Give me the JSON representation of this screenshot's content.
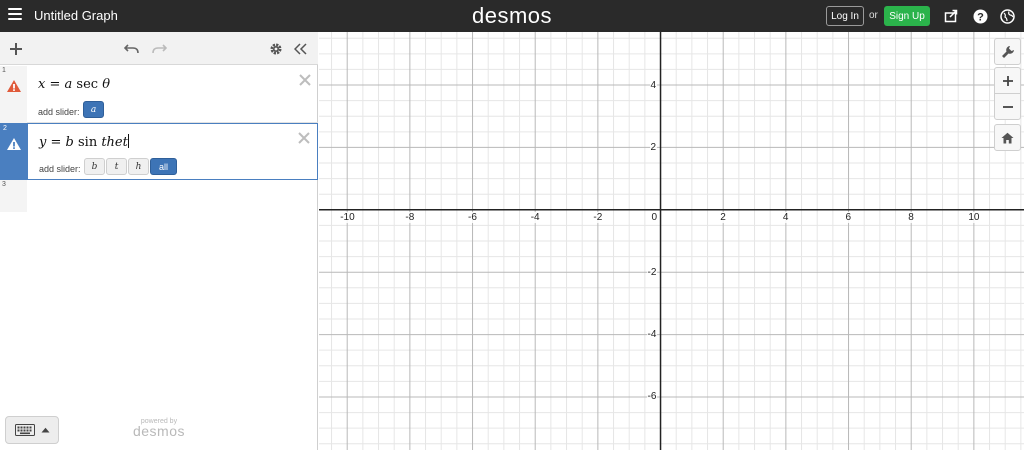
{
  "topbar": {
    "title": "Untitled Graph",
    "brand": "desmos",
    "login_label": "Log In",
    "or_label": "or",
    "signup_label": "Sign Up",
    "icons": [
      "menu-icon",
      "share-icon",
      "help-icon",
      "globe-icon"
    ]
  },
  "panel": {
    "header_icons": [
      "add-icon",
      "undo-icon",
      "redo-icon",
      "settings-icon",
      "collapse-icon"
    ],
    "expressions": [
      {
        "num": "1",
        "latex": "x = a sec θ",
        "parts": {
          "v1": "x",
          "eq": " = ",
          "v2": "a",
          "fn": " sec ",
          "v3": "θ"
        },
        "status": "error",
        "slider_label": "add slider:",
        "sliders": [
          "a"
        ]
      },
      {
        "num": "2",
        "latex": "y = b sin thet",
        "parts": {
          "v1": "y",
          "eq": " = ",
          "v2": "b",
          "fn": " sin ",
          "v3": "thet"
        },
        "status": "warning",
        "selected": true,
        "slider_label": "add slider:",
        "sliders": [
          "b",
          "t",
          "h"
        ],
        "all_label": "all"
      },
      {
        "num": "3"
      }
    ],
    "powered_by": "powered by",
    "powered_brand": "desmos"
  },
  "graph": {
    "x_labels": [
      "-10",
      "-8",
      "-6",
      "-4",
      "-2",
      "0",
      "2",
      "4",
      "6",
      "8",
      "10"
    ],
    "y_labels": [
      "4",
      "2",
      "-2",
      "-4",
      "-6"
    ],
    "xlim": [
      -10.9,
      11.6
    ],
    "ylim": [
      -7.7,
      5.7
    ],
    "colors": {
      "major": "#b8b8b8",
      "minor": "#e6e6e6",
      "axis": "#222222"
    },
    "tools": [
      "wrench-icon",
      "zoom-in-icon",
      "zoom-out-icon",
      "home-icon"
    ]
  },
  "colors": {
    "error": "#e05a3a",
    "warning_bg": "#4a7fc0",
    "accent": "#3d74b6",
    "signup": "#2bb34b"
  }
}
